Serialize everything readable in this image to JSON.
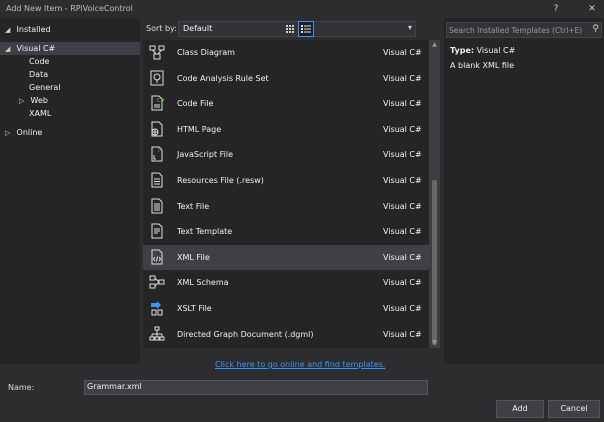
{
  "window": {
    "title": "Add New Item - RPiVoiceControl",
    "help": "?",
    "close": "✕"
  },
  "tree": {
    "installed": "Installed",
    "visual_csharp": "Visual C#",
    "code": "Code",
    "data": "Data",
    "general": "General",
    "web": "Web",
    "xaml": "XAML",
    "online": "Online"
  },
  "toolbar": {
    "sort_label": "Sort by:",
    "sort_value": "Default"
  },
  "templates": [
    {
      "name": "Class Diagram",
      "lang": "Visual C#",
      "icon": "class-diagram-icon"
    },
    {
      "name": "Code Analysis Rule Set",
      "lang": "Visual C#",
      "icon": "rule-set-icon"
    },
    {
      "name": "Code File",
      "lang": "Visual C#",
      "icon": "code-file-icon"
    },
    {
      "name": "HTML Page",
      "lang": "Visual C#",
      "icon": "html-page-icon"
    },
    {
      "name": "JavaScript File",
      "lang": "Visual C#",
      "icon": "javascript-file-icon"
    },
    {
      "name": "Resources File (.resw)",
      "lang": "Visual C#",
      "icon": "resources-file-icon"
    },
    {
      "name": "Text File",
      "lang": "Visual C#",
      "icon": "text-file-icon"
    },
    {
      "name": "Text Template",
      "lang": "Visual C#",
      "icon": "text-template-icon"
    },
    {
      "name": "XML File",
      "lang": "Visual C#",
      "icon": "xml-file-icon"
    },
    {
      "name": "XML Schema",
      "lang": "Visual C#",
      "icon": "xml-schema-icon"
    },
    {
      "name": "XSLT File",
      "lang": "Visual C#",
      "icon": "xslt-file-icon"
    },
    {
      "name": "Directed Graph Document (.dgml)",
      "lang": "Visual C#",
      "icon": "dgml-icon"
    }
  ],
  "selected_index": 8,
  "details": {
    "type_label": "Type:",
    "type_value": "Visual C#",
    "description": "A blank XML file"
  },
  "search": {
    "placeholder": "Search Installed Templates (Ctrl+E)"
  },
  "online_link": "Click here to go online and find templates.",
  "name_field": {
    "label": "Name:",
    "value": "Grammar.xml"
  },
  "buttons": {
    "add": "Add",
    "cancel": "Cancel"
  },
  "colors": {
    "background": "#2d2d30",
    "panel": "#252526",
    "selection": "#3f3f46",
    "accent": "#3399ff",
    "text": "#f1f1f1"
  }
}
